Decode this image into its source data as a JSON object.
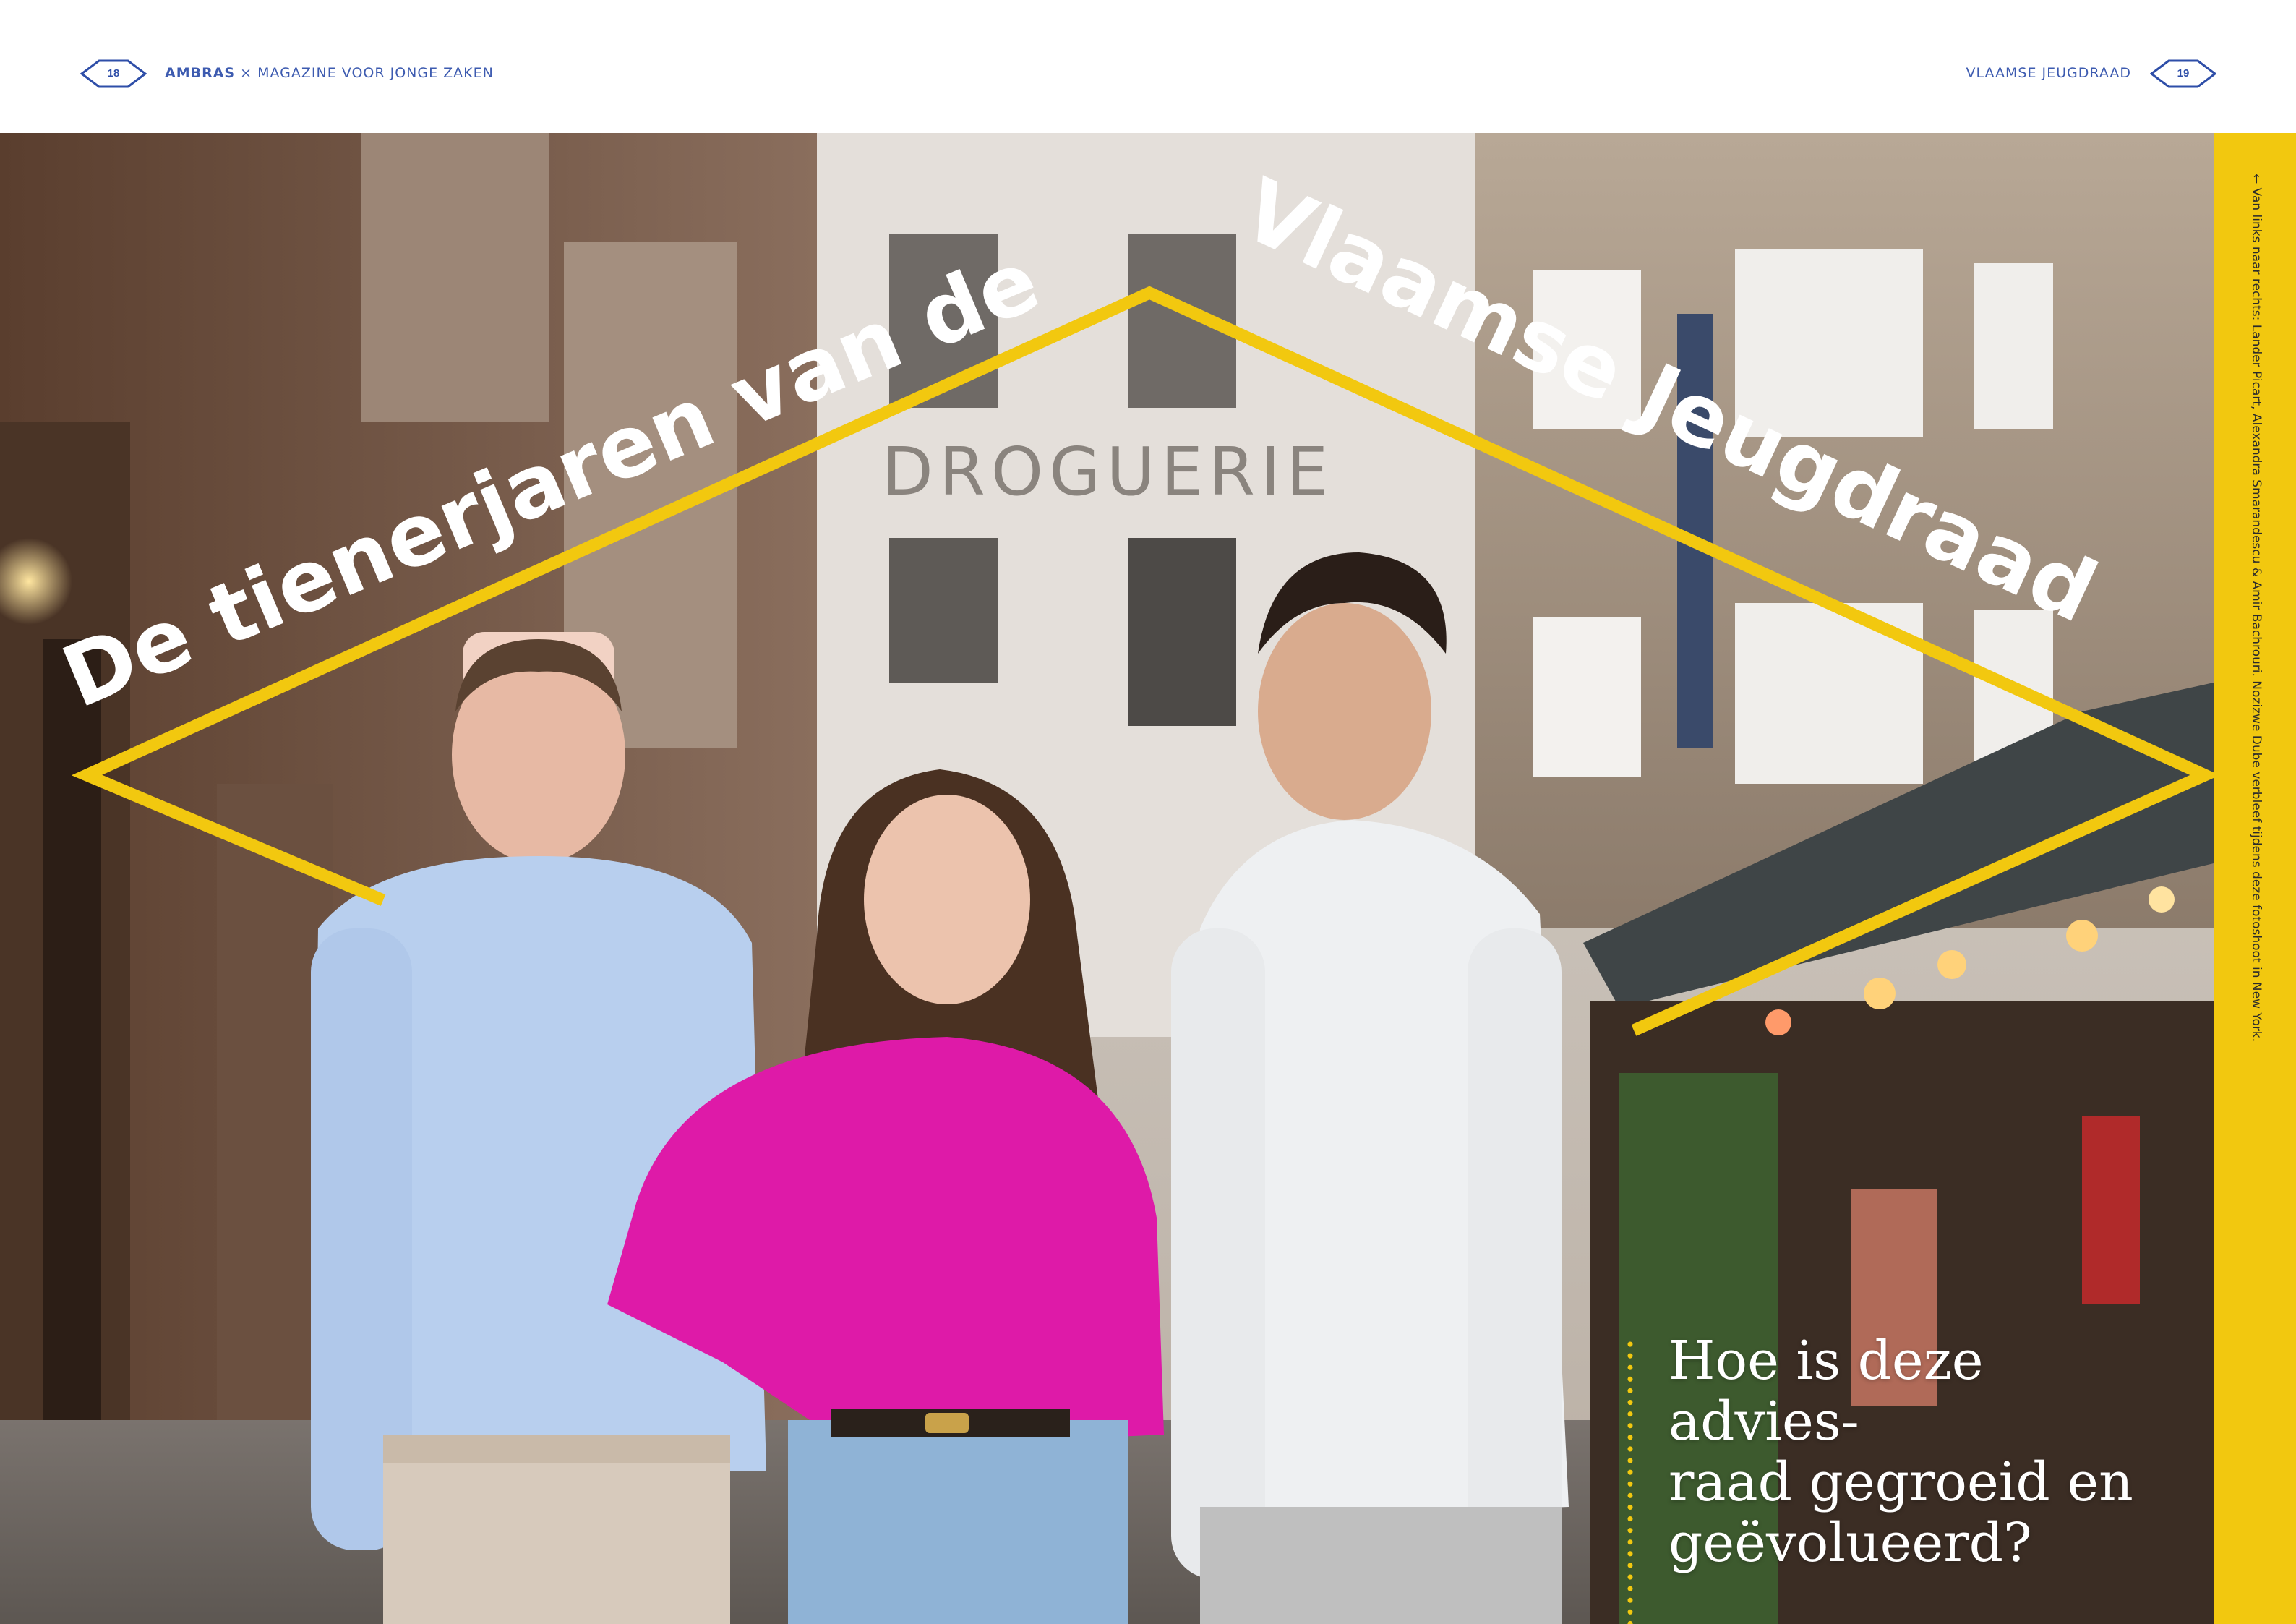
{
  "header": {
    "left_page_number": "18",
    "left_brand": "AMBRAS",
    "left_separator": " × ",
    "left_magazine": "MAGAZINE VOOR JONGE ZAKEN",
    "right_section": "VLAAMSE JEUGDRAAD",
    "right_page_number": "19"
  },
  "title": {
    "line_left": "De tienerjaren van de",
    "line_right": "Vlaamse Jeugdraad"
  },
  "background_sign": "DROGUERIE",
  "question": {
    "line1": "Hoe is deze advies-",
    "line2": "raad gegroeid en",
    "line3": "geëvolueerd?"
  },
  "caption": "← Van links naar rechts: Lander Picart, Alexandra Smarandescu & Amir Bachrouri. Nozizwe Dube verbleef tijdens deze fotoshoot in New York.",
  "colors": {
    "accent_yellow": "#f2c80f",
    "header_blue": "#2e4ea8",
    "title_white": "#ffffff"
  }
}
